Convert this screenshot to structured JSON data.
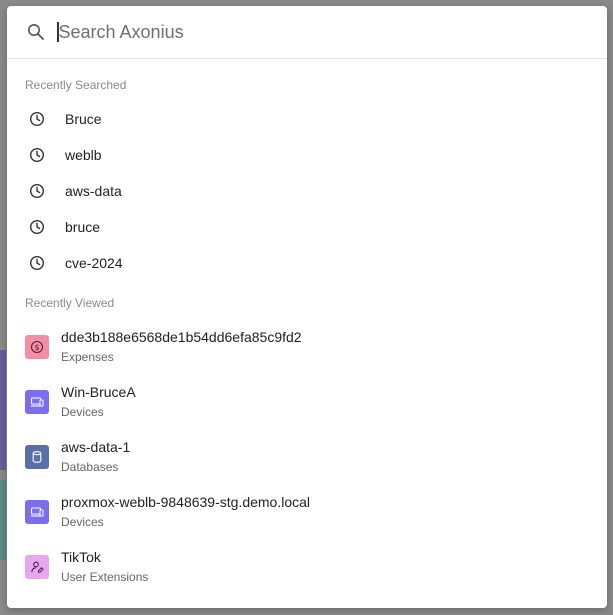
{
  "search": {
    "placeholder": "Search Axonius",
    "icon": "search-icon"
  },
  "recently_searched": {
    "title": "Recently Searched",
    "items": [
      {
        "label": "Bruce",
        "icon": "clock-icon"
      },
      {
        "label": "weblb",
        "icon": "clock-icon"
      },
      {
        "label": "aws-data",
        "icon": "clock-icon"
      },
      {
        "label": "bruce",
        "icon": "clock-icon"
      },
      {
        "label": "cve-2024",
        "icon": "clock-icon"
      }
    ]
  },
  "recently_viewed": {
    "title": "Recently Viewed",
    "items": [
      {
        "name": "dde3b188e6568de1b54dd6efa85c9fd2",
        "category": "Expenses",
        "icon": "dollar-icon",
        "color": "#f28fa6"
      },
      {
        "name": "Win-BruceA",
        "category": "Devices",
        "icon": "devices-icon",
        "color": "#7c6cf0"
      },
      {
        "name": "aws-data-1",
        "category": "Databases",
        "icon": "database-icon",
        "color": "#5a6fa8"
      },
      {
        "name": "proxmox-weblb-9848639-stg.demo.local",
        "category": "Devices",
        "icon": "devices-icon",
        "color": "#7c6cf0"
      },
      {
        "name": "TikTok",
        "category": "User Extensions",
        "icon": "user-extension-icon",
        "color": "#e8a6ef"
      }
    ]
  }
}
